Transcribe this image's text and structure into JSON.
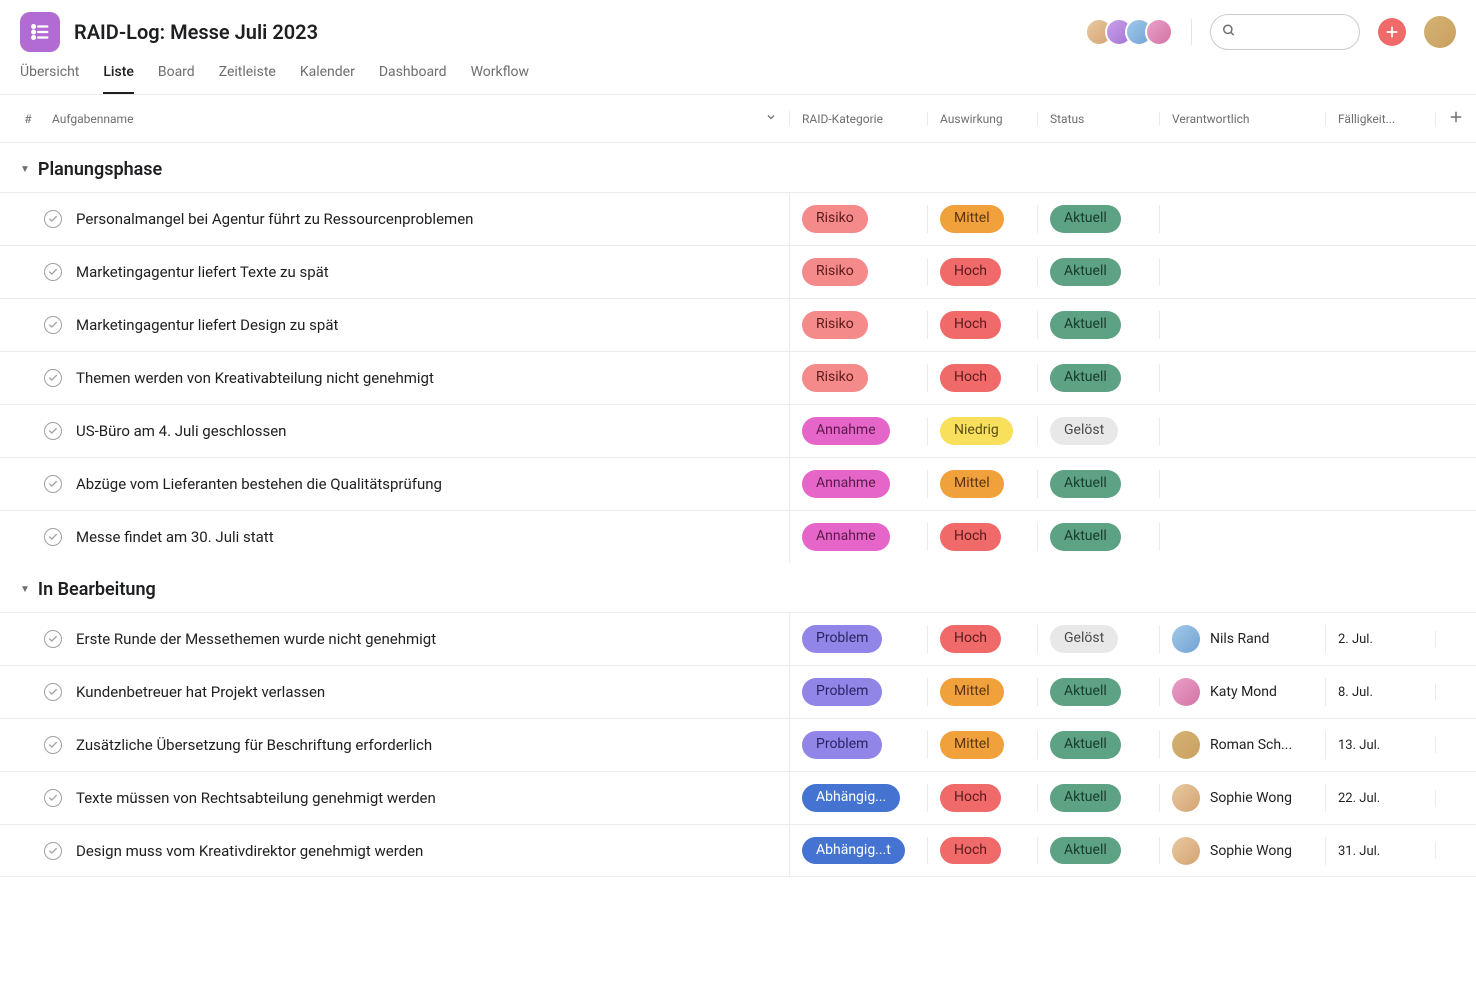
{
  "project": {
    "title": "RAID-Log: Messe Juli 2023"
  },
  "tabs": [
    "Übersicht",
    "Liste",
    "Board",
    "Zeitleiste",
    "Kalender",
    "Dashboard",
    "Workflow"
  ],
  "activeTab": 1,
  "columns": {
    "num": "#",
    "name": "Aufgabenname",
    "cat": "RAID-Kategorie",
    "imp": "Auswirkung",
    "stat": "Status",
    "resp": "Verantwortlich",
    "due": "Fälligkeit..."
  },
  "sections": [
    {
      "title": "Planungsphase",
      "rows": [
        {
          "name": "Personalmangel bei Agentur führt zu Ressourcenproblemen",
          "cat": "Risiko",
          "imp": "Mittel",
          "stat": "Aktuell",
          "resp": "",
          "due": ""
        },
        {
          "name": "Marketingagentur liefert Texte zu spät",
          "cat": "Risiko",
          "imp": "Hoch",
          "stat": "Aktuell",
          "resp": "",
          "due": ""
        },
        {
          "name": "Marketingagentur liefert Design zu spät",
          "cat": "Risiko",
          "imp": "Hoch",
          "stat": "Aktuell",
          "resp": "",
          "due": ""
        },
        {
          "name": "Themen werden von Kreativabteilung nicht genehmigt",
          "cat": "Risiko",
          "imp": "Hoch",
          "stat": "Aktuell",
          "resp": "",
          "due": ""
        },
        {
          "name": "US-Büro am 4. Juli geschlossen",
          "cat": "Annahme",
          "imp": "Niedrig",
          "stat": "Gelöst",
          "resp": "",
          "due": ""
        },
        {
          "name": "Abzüge vom Lieferanten bestehen die Qualitätsprüfung",
          "cat": "Annahme",
          "imp": "Mittel",
          "stat": "Aktuell",
          "resp": "",
          "due": ""
        },
        {
          "name": "Messe findet am 30. Juli statt",
          "cat": "Annahme",
          "imp": "Hoch",
          "stat": "Aktuell",
          "resp": "",
          "due": ""
        }
      ]
    },
    {
      "title": "In Bearbeitung",
      "rows": [
        {
          "name": "Erste Runde der Messethemen wurde nicht genehmigt",
          "cat": "Problem",
          "imp": "Hoch",
          "stat": "Gelöst",
          "resp": "Nils Rand",
          "due": "2. Jul."
        },
        {
          "name": "Kundenbetreuer hat Projekt verlassen",
          "cat": "Problem",
          "imp": "Mittel",
          "stat": "Aktuell",
          "resp": "Katy Mond",
          "due": "8. Jul."
        },
        {
          "name": "Zusätzliche Übersetzung für Beschriftung erforderlich",
          "cat": "Problem",
          "imp": "Mittel",
          "stat": "Aktuell",
          "resp": "Roman Sch...",
          "due": "13. Jul."
        },
        {
          "name": "Texte müssen von Rechtsabteilung genehmigt werden",
          "cat": "Abhängig...",
          "imp": "Hoch",
          "stat": "Aktuell",
          "resp": "Sophie Wong",
          "due": "22. Jul."
        },
        {
          "name": "Design muss vom Kreativdirektor genehmigt werden",
          "cat": "Abhängig...t",
          "imp": "Hoch",
          "stat": "Aktuell",
          "resp": "Sophie Wong",
          "due": "31. Jul."
        }
      ]
    }
  ],
  "pillClasses": {
    "Risiko": "pill-risiko",
    "Annahme": "pill-annahme",
    "Problem": "pill-problem",
    "Abhängig...": "pill-abhang",
    "Abhängig...t": "pill-abhang",
    "Hoch": "pill-hoch",
    "Mittel": "pill-mittel",
    "Niedrig": "pill-niedrig",
    "Aktuell": "pill-aktuell",
    "Gelöst": "pill-gelost"
  },
  "avatarClasses": {
    "Nils Rand": "av-3",
    "Katy Mond": "av-4",
    "Roman Sch...": "av-5",
    "Sophie Wong": "av-1"
  }
}
